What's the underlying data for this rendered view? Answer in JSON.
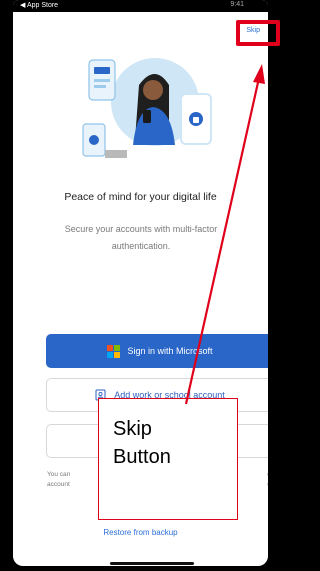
{
  "statusbar": {
    "back_label": "◀ App Store",
    "clock": "9:41"
  },
  "header": {
    "skip_label": "Skip"
  },
  "content": {
    "headline": "Peace of mind for your digital life",
    "subline": "Secure your accounts with multi-factor authentication."
  },
  "buttons": {
    "sign_in_label": "Sign in with Microsoft",
    "add_account_label": "Add work or school account"
  },
  "fine_print": {
    "left": "You can",
    "left2": "account",
    "right": "or",
    "right2": "or"
  },
  "restore_label": "Restore from backup",
  "annotation": {
    "line1": "Skip",
    "line2": "Button"
  },
  "colors": {
    "accent": "#2a66c8",
    "link": "#2b6fd6",
    "annotation_red": "#e0001b",
    "ms_red": "#f25022",
    "ms_green": "#7fba00",
    "ms_blue": "#00a4ef",
    "ms_yellow": "#ffb900"
  }
}
